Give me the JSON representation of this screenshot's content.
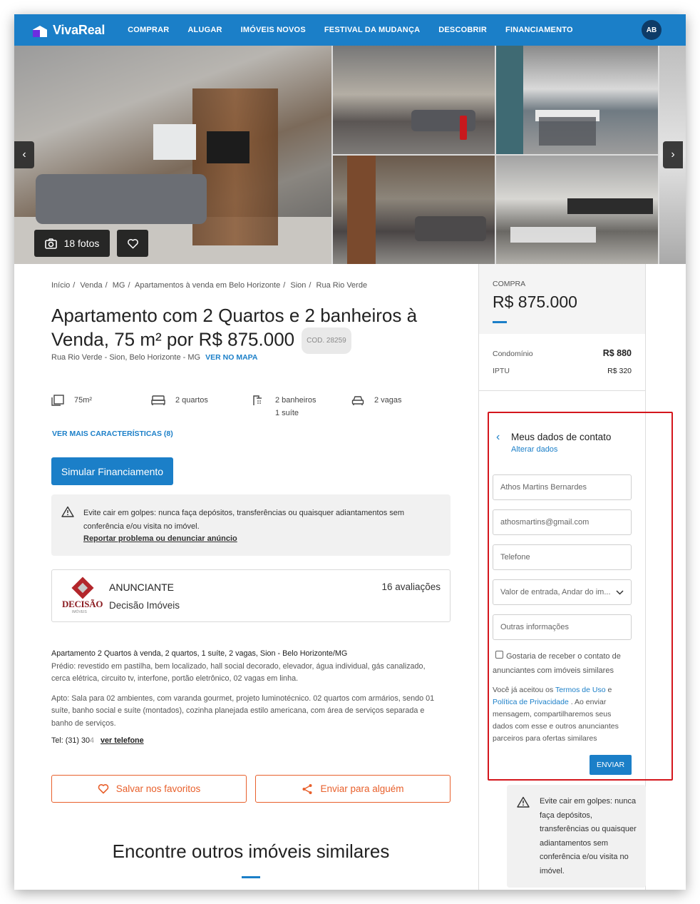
{
  "header": {
    "brand": "VivaReal",
    "nav": [
      "COMPRAR",
      "ALUGAR",
      "IMÓVEIS NOVOS",
      "FESTIVAL DA MUDANÇA",
      "DESCOBRIR",
      "FINANCIAMENTO"
    ],
    "avatar_initials": "AB",
    "brand_color": "#1b7fc8"
  },
  "gallery": {
    "photos_label": "18 fotos",
    "prev_icon": "chevron-left-icon",
    "next_icon": "chevron-right-icon"
  },
  "breadcrumb": [
    "Início",
    "Venda",
    "MG",
    "Apartamentos à venda em Belo Horizonte",
    "Sion",
    "Rua Rio Verde"
  ],
  "listing": {
    "title": "Apartamento com 2 Quartos e 2 banheiros à Venda, 75 m² por R$ 875.000",
    "code": "COD. 28259",
    "address": "Rua Rio Verde - Sion, Belo Horizonte - MG",
    "map_link": "VER NO MAPA",
    "features": {
      "area": "75m²",
      "bedrooms": "2 quartos",
      "bathrooms": "2 banheiros",
      "suite": "1 suíte",
      "parking": "2 vagas"
    },
    "more_features": "VER MAIS CARACTERÍSTICAS (8)",
    "simulate_button": "Simular Financiamento"
  },
  "warning": {
    "text": "Evite cair em golpes: nunca faça depósitos, transferências ou quaisquer adiantamentos sem conferência e/ou visita no imóvel.",
    "report_link": "Reportar problema ou denunciar anúncio"
  },
  "advertiser": {
    "label": "ANUNCIANTE",
    "name": "Decisão Imóveis",
    "reviews": "16 avaliações",
    "logo_text": "DECISÃO",
    "logo_sub": "IMÓVEIS"
  },
  "description": {
    "lead": "Apartamento 2 Quartos à venda, 2 quartos, 1 suíte, 2 vagas, Sion - Belo Horizonte/MG",
    "building": "Prédio: revestido em pastilha, bem localizado, hall social decorado, elevador, água individual, gás canalizado, cerca elétrica, circuito tv, interfone, portão eletrônico, 02 vagas em linha.",
    "apt": "Apto: Sala para 02 ambientes, com varanda gourmet, projeto luminotécnico. 02 quartos com armários, sendo 01 suíte, banho social e suíte (montados), cozinha planejada estilo americana, com área de serviços separada e banho de serviços.",
    "tel_prefix": "Tel: (31) 30",
    "tel_hidden": "4",
    "tel_link": "ver telefone"
  },
  "actions": {
    "save": "Salvar nos favoritos",
    "share": "Enviar para alguém"
  },
  "similar": {
    "heading": "Encontre outros imóveis similares"
  },
  "sidebar": {
    "price_label": "COMPRA",
    "price": "R$ 875.000",
    "condo_label": "Condomínio",
    "condo_value": "R$ 880",
    "iptu_label": "IPTU",
    "iptu_value": "R$ 320"
  },
  "contact_form": {
    "title": "Meus dados de contato",
    "alter_link": "Alterar dados",
    "name_value": "Athos Martins Bernardes",
    "email_value": "athosmartins@gmail.com",
    "phone_placeholder": "Telefone",
    "select_value": "Valor de entrada, Andar do im...",
    "other_placeholder": "Outras informações",
    "checkbox_label": "Gostaria de receber o contato de anunciantes com imóveis similares",
    "terms_prefix": "Você já aceitou os",
    "terms_link": "Termos de Uso",
    "terms_and": "e",
    "privacy_link": "Política de Privacidade",
    "terms_suffix": ". Ao enviar mensagem, compartilharemos seus dados com esse e outros anunciantes parceiros para ofertas similares",
    "send_button": "ENVIAR"
  },
  "sidebar_warning": {
    "text": "Evite cair em golpes: nunca faça depósitos, transferências ou quaisquer adiantamentos sem conferência e/ou visita no imóvel."
  },
  "colors": {
    "primary": "#1b7fc8",
    "accent_orange": "#e8602c",
    "highlight_red": "#d4161c"
  }
}
